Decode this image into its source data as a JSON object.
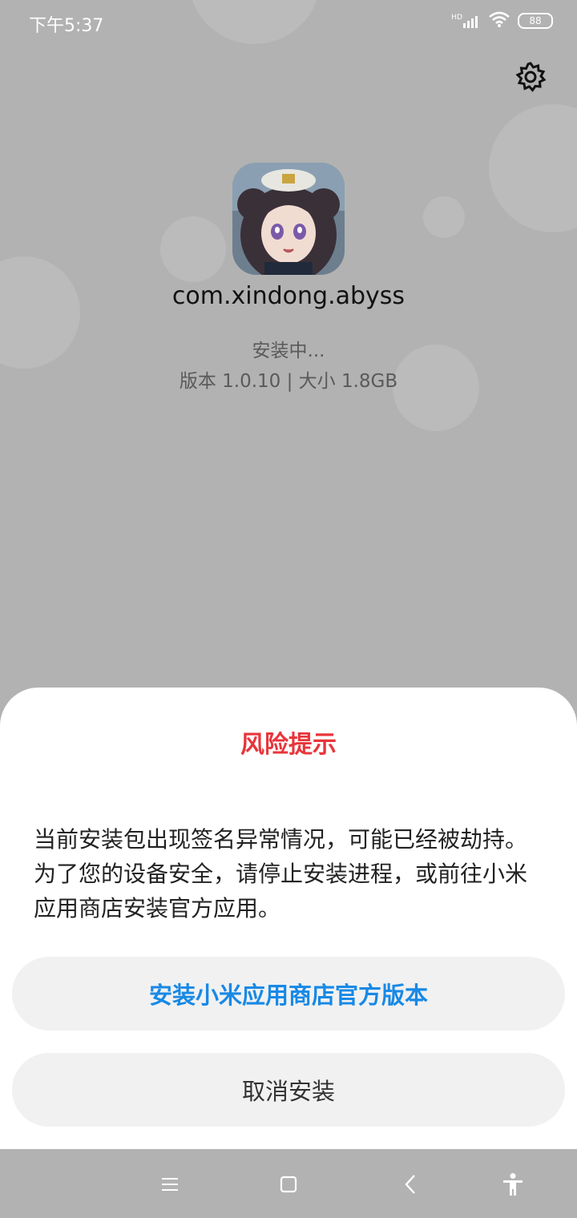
{
  "status_bar": {
    "time": "下午5:37",
    "network_label": "HD",
    "battery": "88",
    "icons": [
      "signal-icon",
      "wifi-icon",
      "battery-icon"
    ]
  },
  "header": {
    "settings_icon": "gear-icon"
  },
  "app": {
    "package_name": "com.xindong.abyss",
    "install_status": "安装中...",
    "meta": "版本 1.0.10 | 大小 1.8GB"
  },
  "dialog": {
    "title": "风险提示",
    "message": "当前安装包出现签名异常情况，可能已经被劫持。为了您的设备安全，请停止安装进程，或前往小米应用商店安装官方应用。",
    "primary_button": "安装小米应用商店官方版本",
    "secondary_button": "取消安装"
  },
  "nav_bar": {
    "items": [
      "menu-icon",
      "home-icon",
      "back-icon",
      "accessibility-icon"
    ]
  },
  "colors": {
    "title_red": "#e8353b",
    "primary_blue": "#1789e6",
    "dim_background": "#b2b2b2",
    "button_bg": "#f1f1f1"
  }
}
